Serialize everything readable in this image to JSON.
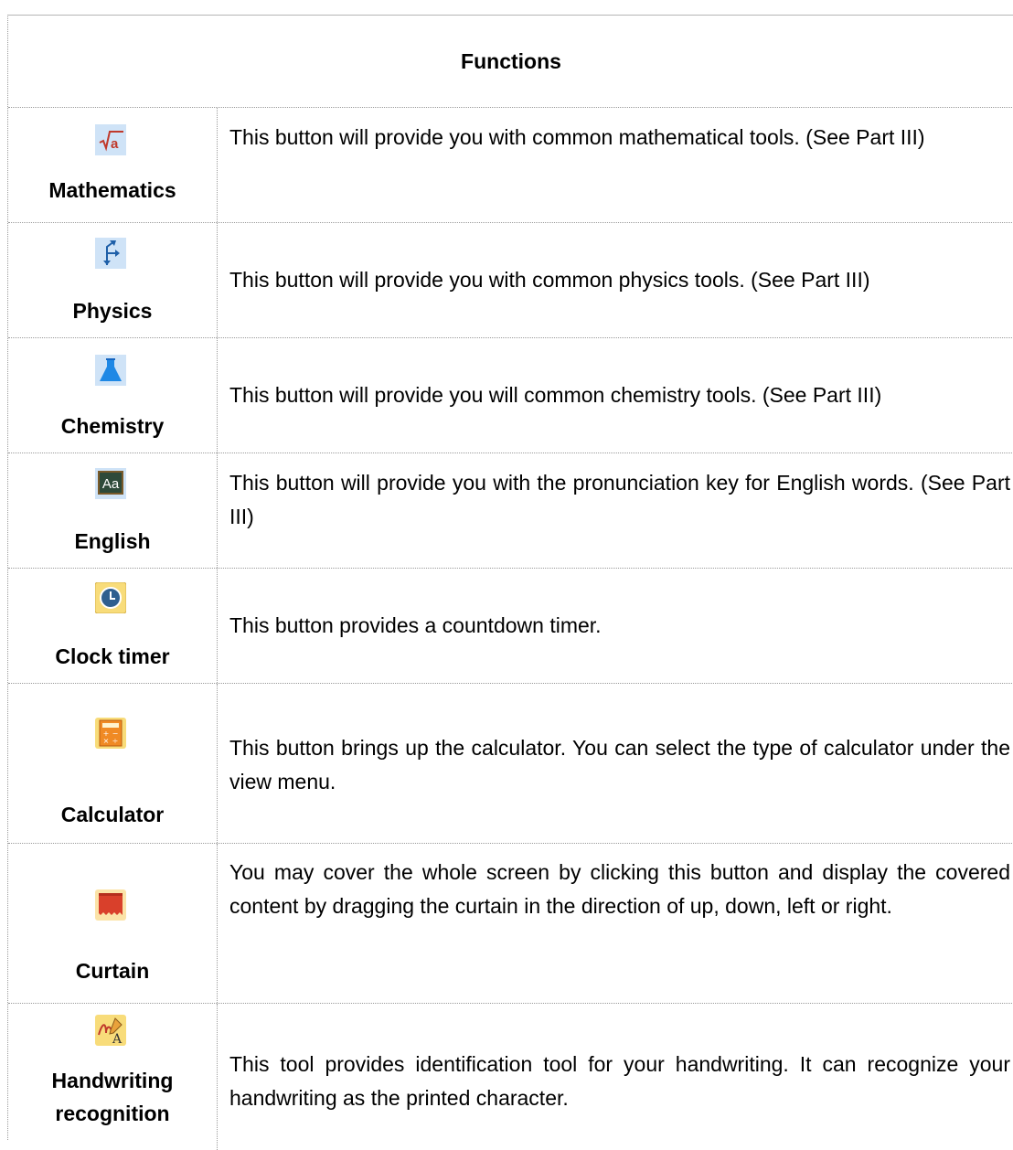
{
  "table": {
    "header": "Functions",
    "rows": [
      {
        "name": "Mathematics",
        "icon": "square-root-icon",
        "description": "This button will provide you with common mathematical tools. (See Part III)"
      },
      {
        "name": "Physics",
        "icon": "vector-arrows-icon",
        "description": "This button will provide you with common physics tools. (See Part III)"
      },
      {
        "name": "Chemistry",
        "icon": "flask-icon",
        "description": "This button will provide you will common chemistry tools. (See Part III)"
      },
      {
        "name": "English",
        "icon": "aa-letters-icon",
        "description": "This button will provide you with the pronunciation key for English words. (See Part III)"
      },
      {
        "name": "Clock timer",
        "icon": "clock-icon",
        "description": "This button provides a countdown timer."
      },
      {
        "name": "Calculator",
        "icon": "calculator-icon",
        "description": "This button brings up the calculator.  You can select the type of calculator under the view menu."
      },
      {
        "name": "Curtain",
        "icon": "curtain-icon",
        "description": "You may cover the whole screen by clicking this button and display the covered content by dragging the curtain in the direction of up, down, left or right."
      },
      {
        "name_line1": "Handwriting",
        "name_line2": "recognition",
        "icon": "handwriting-icon",
        "description": "This tool provides identification tool for your handwriting. It can recognize your handwriting as the printed character."
      }
    ]
  },
  "colors": {
    "icon_bg": "#cfe3f7",
    "math_red": "#c0392b",
    "blue": "#1e88e5",
    "clock_yellow": "#f8dc7a",
    "calc_orange": "#f08a24",
    "curtain_red": "#d9402b"
  }
}
